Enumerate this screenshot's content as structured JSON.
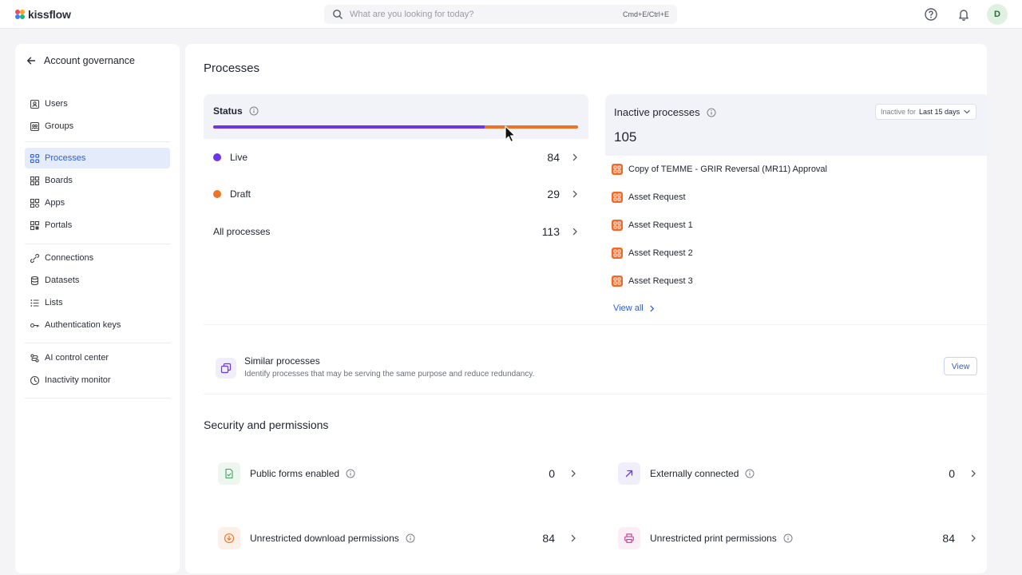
{
  "app": {
    "name": "kissflow"
  },
  "search": {
    "placeholder": "What are you looking for today?",
    "shortcut": "Cmd+E/Ctrl+E"
  },
  "user": {
    "initial": "D"
  },
  "sidebar": {
    "back_title": "Account governance",
    "items": [
      {
        "label": "Users",
        "icon": "user-card-icon"
      },
      {
        "label": "Groups",
        "icon": "group-icon"
      },
      {
        "label": "Processes",
        "icon": "process-icon",
        "active": true
      },
      {
        "label": "Boards",
        "icon": "board-icon"
      },
      {
        "label": "Apps",
        "icon": "apps-icon"
      },
      {
        "label": "Portals",
        "icon": "portal-icon"
      },
      {
        "label": "Connections",
        "icon": "connection-icon"
      },
      {
        "label": "Datasets",
        "icon": "dataset-icon"
      },
      {
        "label": "Lists",
        "icon": "list-icon"
      },
      {
        "label": "Authentication keys",
        "icon": "key-icon"
      },
      {
        "label": "AI control center",
        "icon": "ai-icon"
      },
      {
        "label": "Inactivity monitor",
        "icon": "clock-icon"
      }
    ]
  },
  "main": {
    "title": "Processes",
    "status": {
      "title": "Status",
      "live_fraction": 0.743,
      "rows": [
        {
          "label": "Live",
          "count": "84",
          "color": "#6e36e6"
        },
        {
          "label": "Draft",
          "count": "29",
          "color": "#f07224"
        },
        {
          "label": "All processes",
          "count": "113"
        }
      ]
    },
    "inactive": {
      "title": "Inactive processes",
      "count": "105",
      "filter_label": "Inactive for",
      "filter_value": "Last 15 days",
      "items": [
        "Copy of TEMME - GRIR Reversal (MR11) Approval",
        "Asset Request",
        "Asset Request 1",
        "Asset Request 2",
        "Asset Request 3"
      ],
      "view_all": "View all"
    },
    "similar": {
      "title": "Similar processes",
      "description": "Identify processes that may be serving the same purpose and reduce redundancy.",
      "button": "View"
    },
    "security": {
      "title": "Security and permissions",
      "items": [
        {
          "label": "Public forms enabled",
          "count": "0",
          "icon": "public-form-icon"
        },
        {
          "label": "Externally connected",
          "count": "0",
          "icon": "external-link-icon"
        },
        {
          "label": "Unrestricted download permissions",
          "count": "84",
          "icon": "download-icon"
        },
        {
          "label": "Unrestricted print permissions",
          "count": "84",
          "icon": "print-icon"
        }
      ]
    }
  },
  "colors": {
    "accent": "#2f5fd6",
    "live": "#6e36e6",
    "draft": "#f07224",
    "process_icon": "#f06b2a"
  }
}
